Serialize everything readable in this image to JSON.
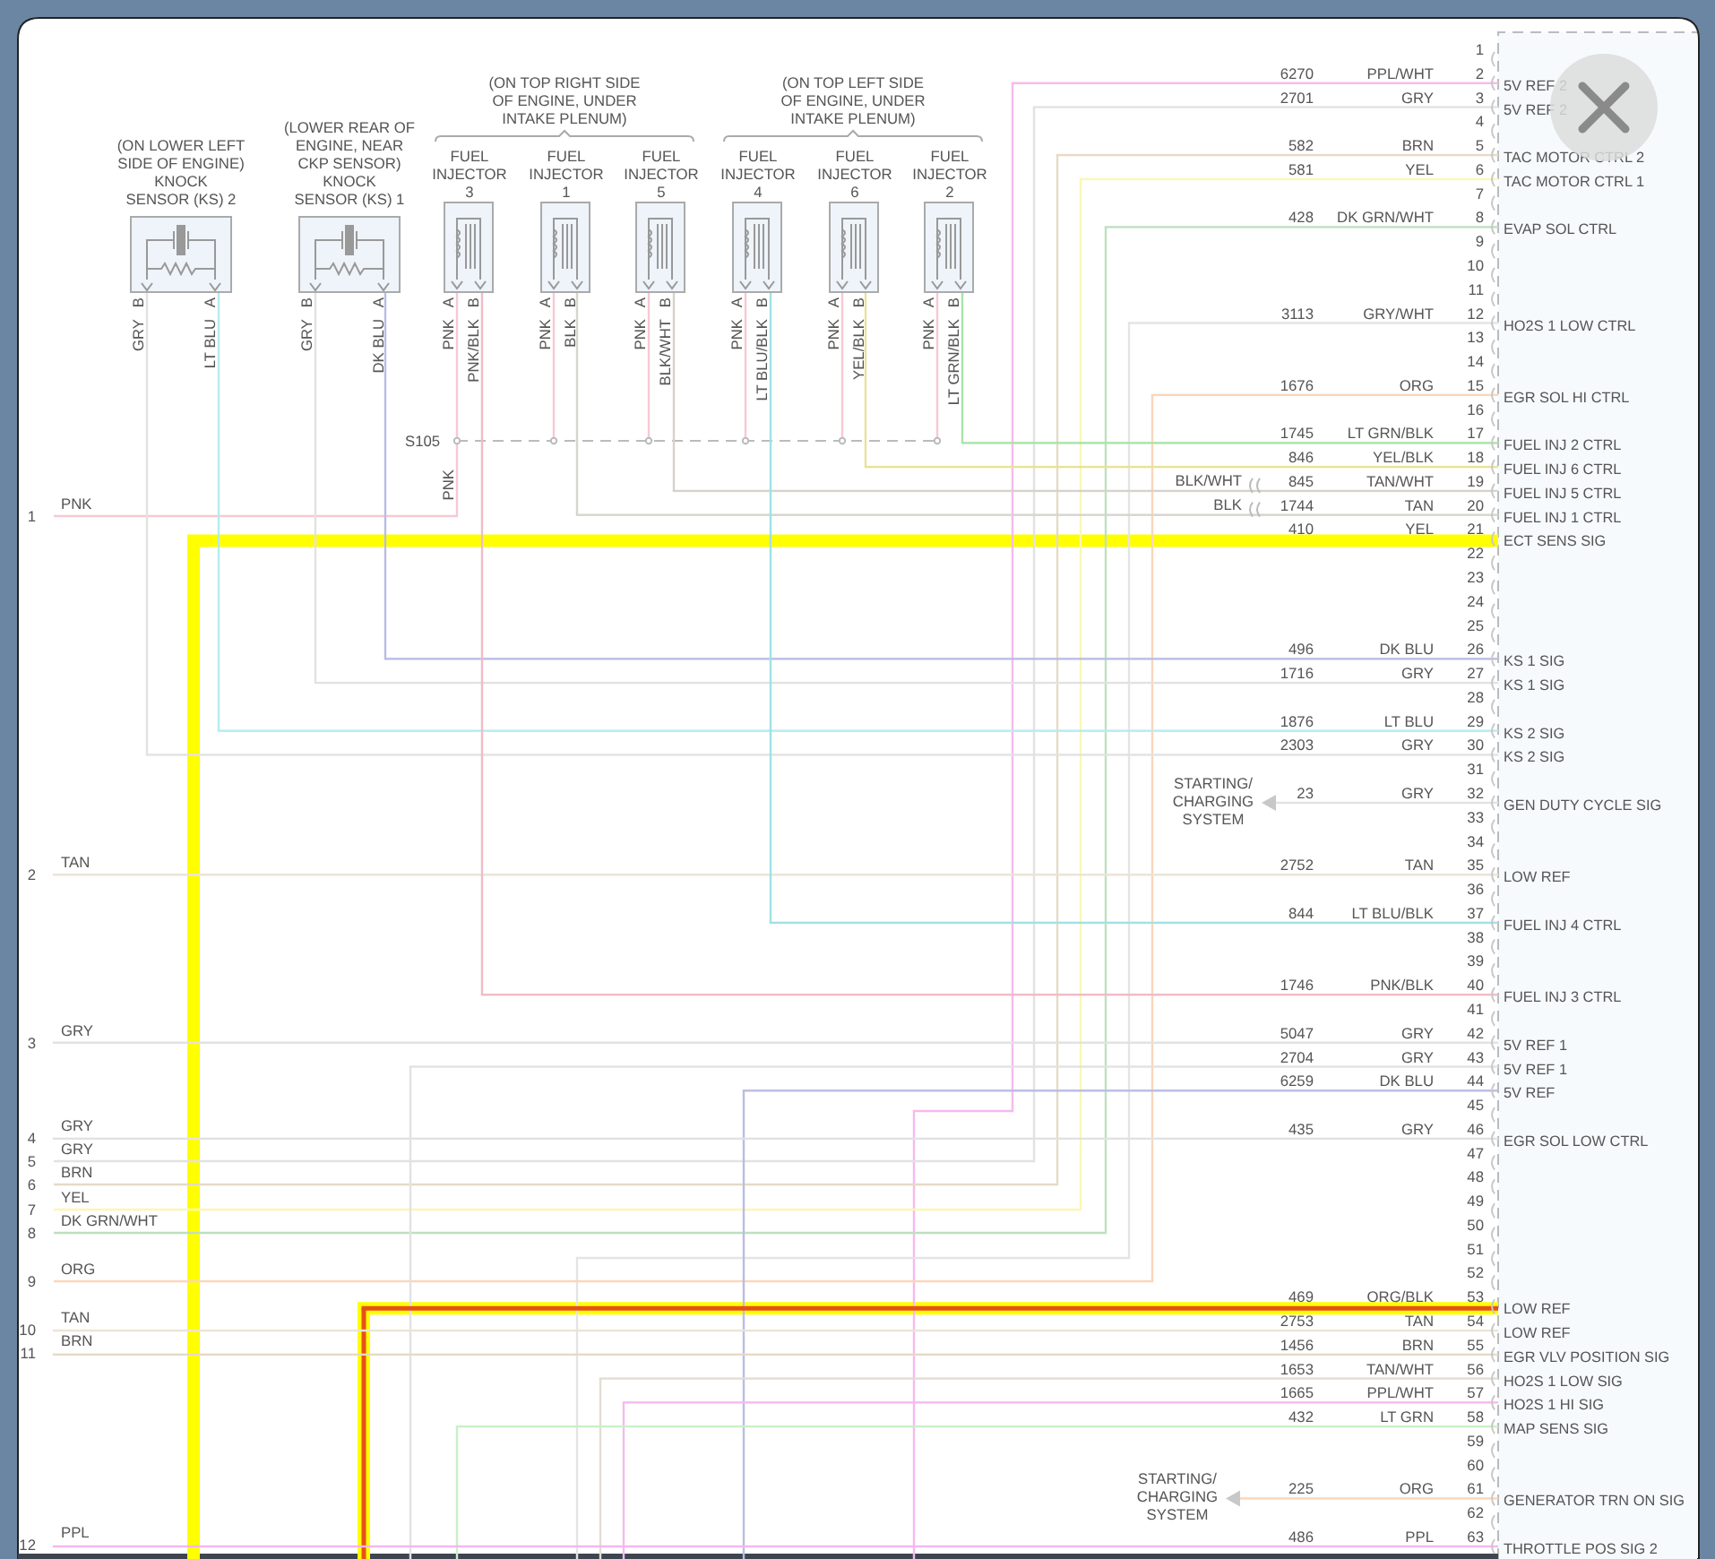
{
  "knock_sensors": [
    {
      "label_lines": [
        "(ON LOWER LEFT",
        "SIDE OF ENGINE)",
        "KNOCK",
        "SENSOR (KS) 2"
      ],
      "pins": [
        {
          "pin": "B",
          "wire": "GRY"
        },
        {
          "pin": "A",
          "wire": "LT BLU"
        }
      ]
    },
    {
      "label_lines": [
        "(LOWER REAR OF",
        "ENGINE, NEAR",
        "CKP SENSOR)",
        "KNOCK",
        "SENSOR (KS) 1"
      ],
      "pins": [
        {
          "pin": "B",
          "wire": "GRY"
        },
        {
          "pin": "A",
          "wire": "DK BLU"
        }
      ]
    }
  ],
  "injector_groups": [
    {
      "location_lines": [
        "(ON TOP RIGHT SIDE",
        "OF ENGINE, UNDER",
        "INTAKE PLENUM)"
      ],
      "injectors": [
        {
          "label_lines": [
            "FUEL",
            "INJECTOR",
            "3"
          ],
          "pins": [
            {
              "pin": "A",
              "wire": "PNK"
            },
            {
              "pin": "B",
              "wire": "PNK/BLK"
            }
          ]
        },
        {
          "label_lines": [
            "FUEL",
            "INJECTOR",
            "1"
          ],
          "pins": [
            {
              "pin": "A",
              "wire": "PNK"
            },
            {
              "pin": "B",
              "wire": "BLK"
            }
          ]
        },
        {
          "label_lines": [
            "FUEL",
            "INJECTOR",
            "5"
          ],
          "pins": [
            {
              "pin": "A",
              "wire": "PNK"
            },
            {
              "pin": "B",
              "wire": "BLK/WHT"
            }
          ]
        }
      ]
    },
    {
      "location_lines": [
        "(ON TOP LEFT SIDE",
        "OF ENGINE, UNDER",
        "INTAKE PLENUM)"
      ],
      "injectors": [
        {
          "label_lines": [
            "FUEL",
            "INJECTOR",
            "4"
          ],
          "pins": [
            {
              "pin": "A",
              "wire": "PNK"
            },
            {
              "pin": "B",
              "wire": "LT BLU/BLK"
            }
          ]
        },
        {
          "label_lines": [
            "FUEL",
            "INJECTOR",
            "6"
          ],
          "pins": [
            {
              "pin": "A",
              "wire": "PNK"
            },
            {
              "pin": "B",
              "wire": "YEL/BLK"
            }
          ]
        },
        {
          "label_lines": [
            "FUEL",
            "INJECTOR",
            "2"
          ],
          "pins": [
            {
              "pin": "A",
              "wire": "PNK"
            },
            {
              "pin": "B",
              "wire": "LT GRN/BLK"
            }
          ]
        }
      ]
    }
  ],
  "splice": {
    "name": "S105",
    "wire": "PNK",
    "color": "#f7c9d3"
  },
  "inline_splices": [
    {
      "wire": "BLK/WHT"
    },
    {
      "wire": "BLK"
    }
  ],
  "left_connector": [
    {
      "number": "1",
      "wire": "PNK"
    },
    {
      "number": "2",
      "wire": "TAN"
    },
    {
      "number": "3",
      "wire": "GRY"
    },
    {
      "number": "4",
      "wire": "GRY"
    },
    {
      "number": "5",
      "wire": "GRY"
    },
    {
      "number": "6",
      "wire": "BRN"
    },
    {
      "number": "7",
      "wire": "YEL"
    },
    {
      "number": "8",
      "wire": "DK GRN/WHT"
    },
    {
      "number": "9",
      "wire": "ORG"
    },
    {
      "number": "10",
      "wire": "TAN"
    },
    {
      "number": "11",
      "wire": "BRN"
    },
    {
      "number": "12",
      "wire": "PPL"
    }
  ],
  "pcm_pins": [
    {
      "number": "1"
    },
    {
      "number": "2",
      "circuit": "6270",
      "wire": "PPL/WHT",
      "function": "5V REF 2",
      "color": "#f7b9ef",
      "highlighted": false,
      "selected": false
    },
    {
      "number": "3",
      "circuit": "2701",
      "wire": "GRY",
      "function": "5V REF 2",
      "color": "#e2e2e2",
      "highlighted": false,
      "selected": false
    },
    {
      "number": "4"
    },
    {
      "number": "5",
      "circuit": "582",
      "wire": "BRN",
      "function": "TAC MOTOR CTRL 2",
      "color": "#e6dac6",
      "highlighted": false,
      "selected": false
    },
    {
      "number": "6",
      "circuit": "581",
      "wire": "YEL",
      "function": "TAC MOTOR CTRL 1",
      "color": "#fbf7b5",
      "highlighted": false,
      "selected": false
    },
    {
      "number": "7"
    },
    {
      "number": "8",
      "circuit": "428",
      "wire": "DK GRN/WHT",
      "function": "EVAP SOL CTRL",
      "color": "#bfe0bf",
      "highlighted": false,
      "selected": false
    },
    {
      "number": "9"
    },
    {
      "number": "10"
    },
    {
      "number": "11"
    },
    {
      "number": "12",
      "circuit": "3113",
      "wire": "GRY/WHT",
      "function": "HO2S 1 LOW CTRL",
      "color": "#e4e4e4",
      "highlighted": false,
      "selected": false
    },
    {
      "number": "13"
    },
    {
      "number": "14"
    },
    {
      "number": "15",
      "circuit": "1676",
      "wire": "ORG",
      "function": "EGR SOL HI CTRL",
      "color": "#fad6bb",
      "highlighted": false,
      "selected": false
    },
    {
      "number": "16"
    },
    {
      "number": "17",
      "circuit": "1745",
      "wire": "LT GRN/BLK",
      "function": "FUEL INJ 2 CTRL",
      "color": "#a9e3a9",
      "highlighted": false,
      "selected": false
    },
    {
      "number": "18",
      "circuit": "846",
      "wire": "YEL/BLK",
      "function": "FUEL INJ 6 CTRL",
      "color": "#e8e29a",
      "highlighted": false,
      "selected": false
    },
    {
      "number": "19",
      "circuit": "845",
      "wire": "TAN/WHT",
      "function": "FUEL INJ 5 CTRL",
      "color": "#d6d2cc",
      "highlighted": false,
      "selected": false
    },
    {
      "number": "20",
      "circuit": "1744",
      "wire": "TAN",
      "function": "FUEL INJ 1 CTRL",
      "color": "#d8d4ce",
      "highlighted": false,
      "selected": false
    },
    {
      "number": "21",
      "circuit": "410",
      "wire": "YEL",
      "function": "ECT SENS SIG",
      "highlighted": true,
      "selected": false
    },
    {
      "number": "22"
    },
    {
      "number": "23"
    },
    {
      "number": "24"
    },
    {
      "number": "25"
    },
    {
      "number": "26",
      "circuit": "496",
      "wire": "DK BLU",
      "function": "KS 1 SIG",
      "color": "#b9bde3",
      "highlighted": false,
      "selected": false
    },
    {
      "number": "27",
      "circuit": "1716",
      "wire": "GRY",
      "function": "KS 1 SIG",
      "color": "#e2e2e2",
      "highlighted": false,
      "selected": false
    },
    {
      "number": "28"
    },
    {
      "number": "29",
      "circuit": "1876",
      "wire": "LT BLU",
      "function": "KS 2 SIG",
      "color": "#b5ecee",
      "highlighted": false,
      "selected": false
    },
    {
      "number": "30",
      "circuit": "2303",
      "wire": "GRY",
      "function": "KS 2 SIG",
      "color": "#e2e2e2",
      "highlighted": false,
      "selected": false
    },
    {
      "number": "31"
    },
    {
      "number": "32",
      "circuit": "23",
      "wire": "GRY",
      "function": "GEN DUTY CYCLE SIG",
      "color": "#e2e2e2",
      "highlighted": false,
      "selected": false,
      "destination_lines": [
        "STARTING/",
        "CHARGING",
        "SYSTEM"
      ]
    },
    {
      "number": "33"
    },
    {
      "number": "34"
    },
    {
      "number": "35",
      "circuit": "2752",
      "wire": "TAN",
      "function": "LOW REF",
      "color": "#ebe4d6",
      "highlighted": false,
      "selected": false
    },
    {
      "number": "36"
    },
    {
      "number": "37",
      "circuit": "844",
      "wire": "LT BLU/BLK",
      "function": "FUEL INJ 4 CTRL",
      "color": "#9fe2e5",
      "highlighted": false,
      "selected": false
    },
    {
      "number": "38"
    },
    {
      "number": "39"
    },
    {
      "number": "40",
      "circuit": "1746",
      "wire": "PNK/BLK",
      "function": "FUEL INJ 3 CTRL",
      "color": "#efbcc6",
      "highlighted": false,
      "selected": false
    },
    {
      "number": "41"
    },
    {
      "number": "42",
      "circuit": "5047",
      "wire": "GRY",
      "function": "5V REF 1",
      "color": "#e2e2e2",
      "highlighted": false,
      "selected": false
    },
    {
      "number": "43",
      "circuit": "2704",
      "wire": "GRY",
      "function": "5V REF 1",
      "color": "#e2e2e2",
      "highlighted": false,
      "selected": false
    },
    {
      "number": "44",
      "circuit": "6259",
      "wire": "DK BLU",
      "function": "5V REF",
      "color": "#b9bde3",
      "highlighted": false,
      "selected": false
    },
    {
      "number": "45"
    },
    {
      "number": "46",
      "circuit": "435",
      "wire": "GRY",
      "function": "EGR SOL LOW CTRL",
      "color": "#e2e2e2",
      "highlighted": false,
      "selected": false
    },
    {
      "number": "47"
    },
    {
      "number": "48"
    },
    {
      "number": "49"
    },
    {
      "number": "50"
    },
    {
      "number": "51"
    },
    {
      "number": "52"
    },
    {
      "number": "53",
      "circuit": "469",
      "wire": "ORG/BLK",
      "function": "LOW REF",
      "highlighted": true,
      "selected": true
    },
    {
      "number": "54",
      "circuit": "2753",
      "wire": "TAN",
      "function": "LOW REF",
      "color": "#ebe4d6",
      "highlighted": false,
      "selected": false
    },
    {
      "number": "55",
      "circuit": "1456",
      "wire": "BRN",
      "function": "EGR VLV POSITION SIG",
      "color": "#e6dac6",
      "highlighted": false,
      "selected": false
    },
    {
      "number": "56",
      "circuit": "1653",
      "wire": "TAN/WHT",
      "function": "HO2S 1 LOW SIG",
      "color": "#e3ddd3",
      "highlighted": false,
      "selected": false
    },
    {
      "number": "57",
      "circuit": "1665",
      "wire": "PPL/WHT",
      "function": "HO2S 1 HI SIG",
      "color": "#f7b9ef",
      "highlighted": false,
      "selected": false
    },
    {
      "number": "58",
      "circuit": "432",
      "wire": "LT GRN",
      "function": "MAP SENS SIG",
      "color": "#c8f0c8",
      "highlighted": false,
      "selected": false
    },
    {
      "number": "59"
    },
    {
      "number": "60"
    },
    {
      "number": "61",
      "circuit": "225",
      "wire": "ORG",
      "function": "GENERATOR TRN ON SIG",
      "color": "#fad6bb",
      "highlighted": false,
      "selected": false,
      "destination_lines": [
        "STARTING/",
        "CHARGING",
        "SYSTEM"
      ]
    },
    {
      "number": "62"
    },
    {
      "number": "63",
      "circuit": "486",
      "wire": "PPL",
      "function": "THROTTLE POS SIG 2",
      "color": "#f5b5f1",
      "highlighted": false,
      "selected": false
    }
  ]
}
